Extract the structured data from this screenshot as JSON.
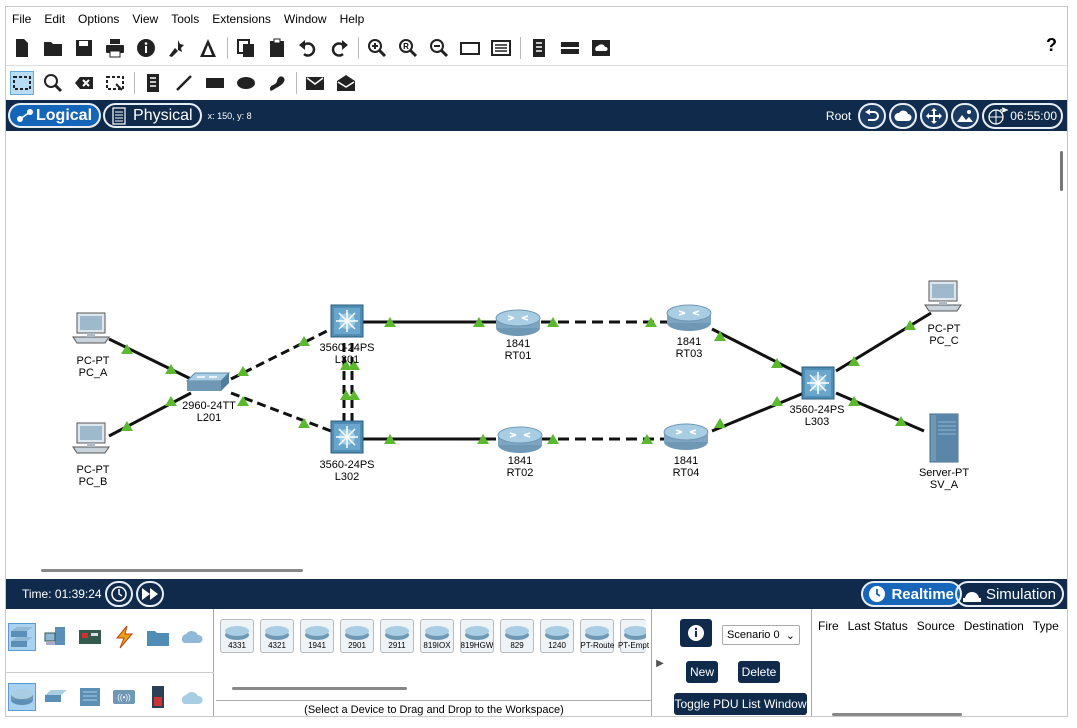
{
  "menu": [
    "File",
    "Edit",
    "Options",
    "View",
    "Tools",
    "Extensions",
    "Window",
    "Help"
  ],
  "toolbar_icons": [
    "new-file-icon",
    "open-folder-icon",
    "save-icon",
    "print-icon",
    "info-icon",
    "activity-wizard-icon",
    "pt-icon",
    "copy-icon",
    "paste-icon",
    "undo-icon",
    "redo-icon",
    "zoom-in-icon",
    "zoom-reset-icon",
    "zoom-out-icon",
    "drawing-palette-icon",
    "custom-device-icon",
    "list-icon",
    "server-icon",
    "cloud-icon"
  ],
  "help_label": "?",
  "tool_icons": [
    "select-icon",
    "inspect-icon",
    "delete-icon",
    "resize-icon",
    "note-icon",
    "line-icon",
    "rectangle-icon",
    "ellipse-icon",
    "freeform-icon",
    "simple-pdu-icon",
    "complex-pdu-icon"
  ],
  "nav": {
    "logical_label": "Logical",
    "physical_label": "Physical",
    "coords": "x: 150, y: 8",
    "root_label": "Root",
    "clock": "06:55:00"
  },
  "devices": {
    "pc_a": {
      "type": "PC-PT",
      "name": "PC_A"
    },
    "pc_b": {
      "type": "PC-PT",
      "name": "PC_B"
    },
    "pc_c": {
      "type": "PC-PT",
      "name": "PC_C"
    },
    "sv_a": {
      "type": "Server-PT",
      "name": "SV_A"
    },
    "l201": {
      "type": "2960-24TT",
      "name": "L201"
    },
    "l301": {
      "type": "3560-24PS",
      "name": "L301"
    },
    "l302": {
      "type": "3560-24PS",
      "name": "L302"
    },
    "l303": {
      "type": "3560-24PS",
      "name": "L303"
    },
    "rt01": {
      "type": "1841",
      "name": "RT01"
    },
    "rt02": {
      "type": "1841",
      "name": "RT02"
    },
    "rt03": {
      "type": "1841",
      "name": "RT03"
    },
    "rt04": {
      "type": "1841",
      "name": "RT04"
    }
  },
  "status": {
    "time": "Time: 01:39:24",
    "realtime_label": "Realtime",
    "simulation_label": "Simulation"
  },
  "device_models": [
    "4331",
    "4321",
    "1941",
    "2901",
    "2911",
    "819IOX",
    "819HGW",
    "829",
    "1240",
    "PT-Router",
    "PT-Empt"
  ],
  "device_hint": "(Select a Device to Drag and Drop to the Workspace)",
  "scenario": {
    "select_value": "Scenario 0",
    "new_label": "New",
    "delete_label": "Delete",
    "toggle_label": "Toggle PDU List Window"
  },
  "pdu_columns": [
    "Fire",
    "Last Status",
    "Source",
    "Destination",
    "Type"
  ],
  "colors": {
    "navy": "#0f2a4a",
    "active_blue": "#1565b8",
    "link_green": "#5cb82e"
  }
}
